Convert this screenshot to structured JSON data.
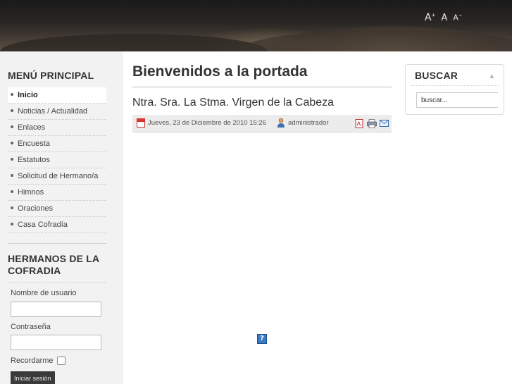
{
  "header": {
    "font_controls": [
      "A+",
      "A",
      "A-"
    ]
  },
  "menu": {
    "title": "MENÚ PRINCIPAL",
    "items": [
      {
        "label": "Inicio",
        "active": true
      },
      {
        "label": "Noticias / Actualidad"
      },
      {
        "label": "Enlaces"
      },
      {
        "label": "Encuesta"
      },
      {
        "label": "Estatutos"
      },
      {
        "label": "Solicitud de Hermano/a"
      },
      {
        "label": "Himnos"
      },
      {
        "label": "Oraciones"
      },
      {
        "label": "Casa Cofradía"
      }
    ]
  },
  "login": {
    "title": "HERMANOS DE LA COFRADIA",
    "username_label": "Nombre de usuario",
    "password_label": "Contraseña",
    "remember_label": "Recordarme",
    "submit_label": "Iniciar sesión"
  },
  "main": {
    "page_title": "Bienvenidos a la portada",
    "article": {
      "title": "Ntra. Sra. La Stma. Virgen de la Cabeza",
      "date": "Jueves, 23 de Diciembre de 2010 15:26",
      "author": "administrador",
      "icons": [
        "calendar-icon",
        "user-icon",
        "pdf-icon",
        "print-icon",
        "email-icon"
      ]
    },
    "help_icon": "?"
  },
  "search": {
    "title": "BUSCAR",
    "input_value": "buscar..."
  },
  "colors": {
    "accent_dark": "#3a3a3a",
    "sidebar_bg": "#f2f2f2",
    "meta_bar_bg": "#ececec",
    "help_blue": "#3a78c8"
  }
}
